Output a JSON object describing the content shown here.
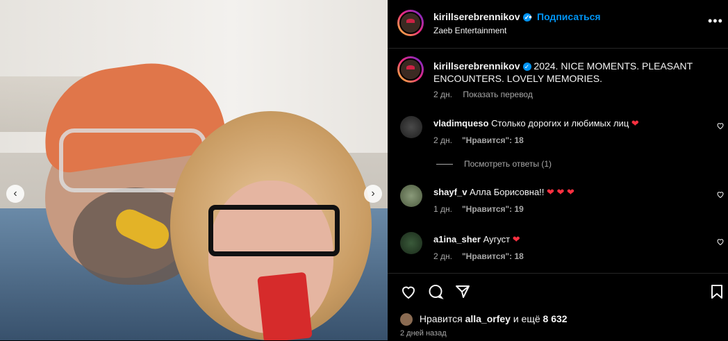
{
  "post": {
    "username": "kirillserebrennikov",
    "verified_mark": "✓",
    "dot": "•",
    "follow_label": "Подписаться",
    "subtitle": "Zaeb Entertainment",
    "more_icon": "•••",
    "caption": "2024. NICE MOMENTS. PLEASANT ENCOUNTERS. LOVELY MEMORIES.",
    "caption_age": "2 дн.",
    "translate_label": "Показать перевод"
  },
  "carousel": {
    "prev": "‹",
    "next": "›"
  },
  "comments": [
    {
      "user": "vladimqueso",
      "text": "Столько дорогих и любимых лиц",
      "hearts": "❤",
      "age": "2 дн.",
      "likes": "\"Нравится\": 18"
    },
    {
      "user": "shayf_v",
      "text": "Алла Борисовна!!",
      "hearts": "❤ ❤ ❤",
      "age": "1 дн.",
      "likes": "\"Нравится\": 19"
    },
    {
      "user": "a1ina_sher",
      "text": "Аугуст",
      "hearts": "❤",
      "age": "2 дн.",
      "likes": "\"Нравится\": 18"
    }
  ],
  "view_replies": "Посмотреть ответы (1)",
  "footer": {
    "liked_by_prefix": "Нравится",
    "liked_by_user": "alla_orfey",
    "liked_by_suffix": "и ещё",
    "liked_by_count": "8 632",
    "time_ago": "2 дней назад"
  },
  "colors": {
    "accent": "#0095f6",
    "heart": "#ff3040",
    "muted": "#a8a8a8"
  }
}
